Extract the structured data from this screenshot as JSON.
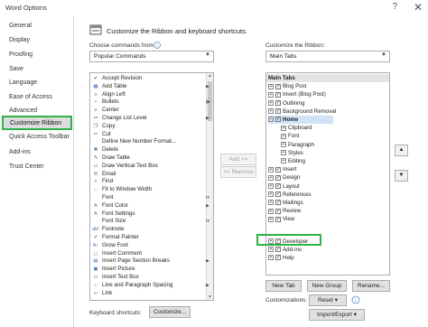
{
  "window": {
    "title": "Word Options",
    "help": "?",
    "close": "✕"
  },
  "nav": {
    "items": [
      "General",
      "Display",
      "Proofing",
      "Save",
      "Language",
      "Ease of Access",
      "Advanced",
      "Quick Access Toolbar",
      "Add-ins",
      "Trust Center"
    ],
    "selected": "Customize Ribbon"
  },
  "header": {
    "text": "Customize the Ribbon and keyboard shortcuts."
  },
  "choose": {
    "label": "Choose commands from:",
    "value": "Popular Commands",
    "info_icon": "info-icon",
    "commands": [
      "Accept Revision",
      "Add Table",
      "Align Left",
      "Bullets",
      "Center",
      "Change List Level",
      "Copy",
      "Cut",
      "Define New Number Format...",
      "Delete",
      "Draw Table",
      "Draw Vertical Text Box",
      "Email",
      "Find",
      "Fit to Window Width",
      "Font",
      "Font Color",
      "Font Settings",
      "Font Size",
      "Footnote",
      "Format Painter",
      "Grow Font",
      "Insert Comment",
      "Insert Page Section Breaks",
      "Insert Picture",
      "Insert Text Box",
      "Line and Paragraph Spacing",
      "Link"
    ]
  },
  "middle": {
    "add": "Add >>",
    "remove": "<< Remove"
  },
  "customize": {
    "label": "Customize the Ribbon:",
    "value": "Main Tabs",
    "header": "Main Tabs",
    "tree": [
      {
        "label": "Blog Post",
        "level": 1
      },
      {
        "label": "Insert (Blog Post)",
        "level": 1
      },
      {
        "label": "Outlining",
        "level": 1
      },
      {
        "label": "Background Removal",
        "level": 1
      },
      {
        "label": "Home",
        "level": 1,
        "expanded": true,
        "selected": true
      },
      {
        "label": "Clipboard",
        "level": 2
      },
      {
        "label": "Font",
        "level": 2
      },
      {
        "label": "Paragraph",
        "level": 2
      },
      {
        "label": "Styles",
        "level": 2
      },
      {
        "label": "Editing",
        "level": 2
      },
      {
        "label": "Insert",
        "level": 1
      },
      {
        "label": "Design",
        "level": 1
      },
      {
        "label": "Layout",
        "level": 1
      },
      {
        "label": "References",
        "level": 1
      },
      {
        "label": "Mailings",
        "level": 1
      },
      {
        "label": "Review",
        "level": 1
      },
      {
        "label": "View",
        "level": 1
      },
      {
        "label": "Developer",
        "level": 1
      },
      {
        "label": "Add-ins",
        "level": 1
      },
      {
        "label": "Help",
        "level": 1
      }
    ],
    "new_tab": "New Tab",
    "new_group": "New Group",
    "rename": "Rename...",
    "customizations_label": "Customizations:",
    "reset": "Reset ▾",
    "import_export": "Import/Export ▾"
  },
  "keyboard": {
    "label": "Keyboard shortcuts:",
    "button": "Customize..."
  },
  "colors": {
    "highlight": "#2db34a",
    "selection": "#dcdcdc"
  }
}
